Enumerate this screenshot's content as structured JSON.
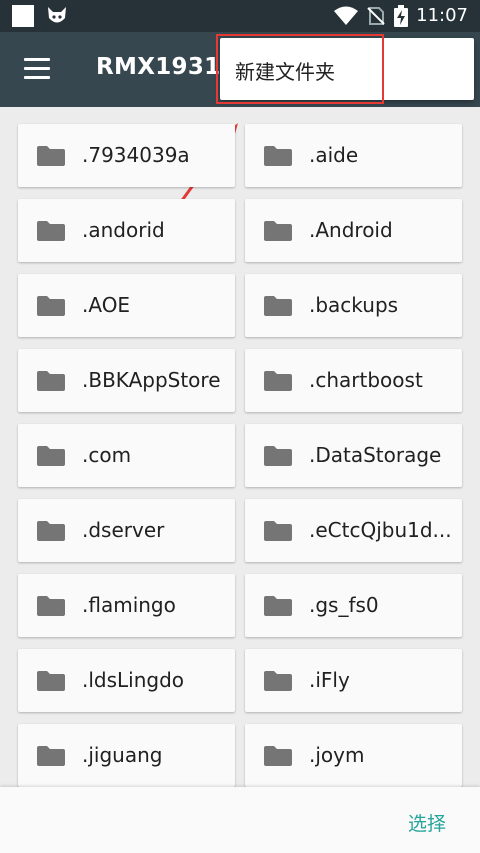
{
  "status_bar": {
    "time": "11:07",
    "icons": [
      "square-icon",
      "cat-icon",
      "wifi-icon",
      "no-sim-icon",
      "battery-charging-icon"
    ]
  },
  "app_bar": {
    "menu_icon": "hamburger-icon",
    "title": "RMX1931"
  },
  "popup_menu": {
    "items": [
      {
        "label": "新建文件夹"
      }
    ]
  },
  "annotation": {
    "highlight_color": "#e53935"
  },
  "folders": [
    {
      "name": ".7934039a"
    },
    {
      "name": ".aide"
    },
    {
      "name": ".andorid"
    },
    {
      "name": ".Android"
    },
    {
      "name": ".AOE"
    },
    {
      "name": ".backups"
    },
    {
      "name": ".BBKAppStore"
    },
    {
      "name": ".chartboost"
    },
    {
      "name": ".com"
    },
    {
      "name": ".DataStorage"
    },
    {
      "name": ".dserver"
    },
    {
      "name": ".eCtcQjbu1d..."
    },
    {
      "name": ".flamingo"
    },
    {
      "name": ".gs_fs0"
    },
    {
      "name": ".ldsLingdo"
    },
    {
      "name": ".iFly"
    },
    {
      "name": ".jiguang"
    },
    {
      "name": ".joym"
    }
  ],
  "bottom_bar": {
    "select_label": "选择"
  },
  "colors": {
    "status_bar": "#263238",
    "app_bar": "#37474f",
    "accent": "#26a69a",
    "folder_icon": "#757575"
  }
}
